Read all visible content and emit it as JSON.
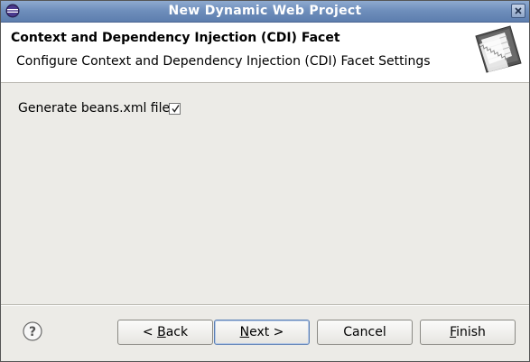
{
  "window": {
    "title": "New Dynamic Web Project"
  },
  "header": {
    "title": "Context and Dependency Injection (CDI) Facet",
    "description": "Configure Context and Dependency Injection (CDI) Facet Settings"
  },
  "form": {
    "generate_beans_label": "Generate beans.xml file:",
    "generate_beans_checked": true
  },
  "buttons": {
    "back_prefix": "< ",
    "back_mnemonic": "B",
    "back_rest": "ack",
    "next_mnemonic": "N",
    "next_rest": "ext >",
    "cancel": "Cancel",
    "finish_mnemonic": "F",
    "finish_rest": "inish"
  },
  "icons": {
    "app": "eclipse-icon",
    "close": "close-icon",
    "header": "wizard-banner-icon",
    "help": "help-icon",
    "checkbox": "checkmark-icon"
  },
  "colors": {
    "titlebar": "#6f8fbc",
    "dialog_bg": "#ecebe7",
    "header_bg": "#ffffff"
  }
}
